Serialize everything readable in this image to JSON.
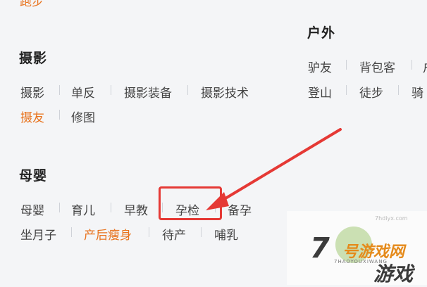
{
  "top_partial_text": "跑步",
  "sections": {
    "photography": {
      "title": "摄影",
      "tags": [
        "摄影",
        "单反",
        "摄影装备",
        "摄影技术",
        "摄友",
        "修图"
      ]
    },
    "outdoor": {
      "title": "户外",
      "tags": [
        "驴友",
        "背包客",
        "户",
        "登山",
        "徒步",
        "骑"
      ]
    },
    "maternity": {
      "title": "母婴",
      "tags": [
        "母婴",
        "育儿",
        "早教",
        "孕检",
        "备孕",
        "坐月子",
        "产后瘦身",
        "待产",
        "哺乳"
      ]
    }
  },
  "watermark": {
    "number": "7",
    "word1": "号游戏网",
    "word2": "游戏",
    "subtitle": "7HAOYOUXIWANG",
    "site": "7hdiyx.com"
  },
  "colors": {
    "accent_orange": "#e8731e",
    "highlight_red": "#e53935",
    "text": "#444444"
  }
}
